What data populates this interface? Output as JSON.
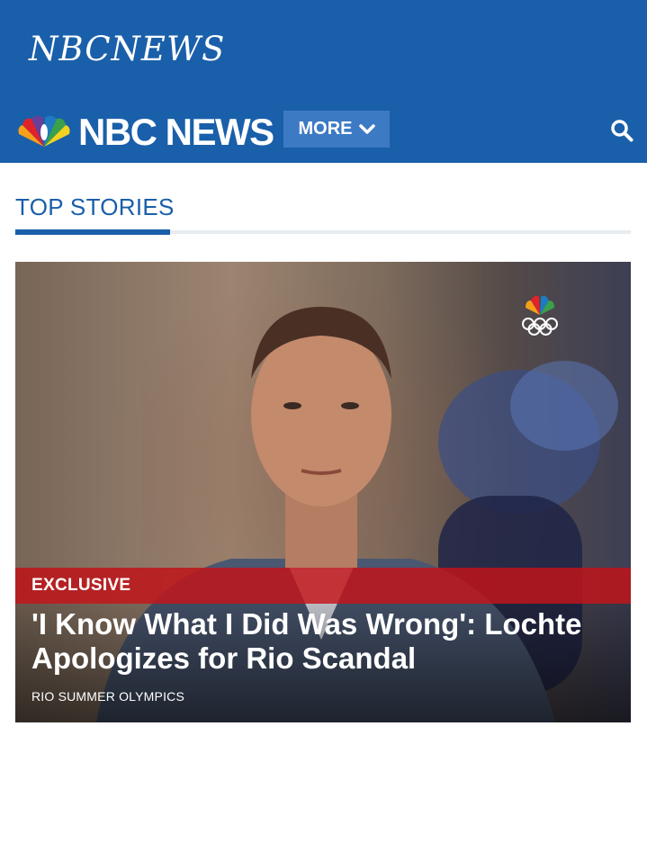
{
  "ad_banner": {
    "logo_text": "NBCNEWS"
  },
  "navbar": {
    "brand": "NBC NEWS",
    "more_label": "MORE"
  },
  "section": {
    "title": "TOP STORIES"
  },
  "hero_story": {
    "badge": "EXCLUSIVE",
    "headline": "'I Know What I Did Was Wrong': Lochte Apologizes for Rio Scandal",
    "category": "RIO SUMMER OLYMPICS"
  },
  "icons": [
    "peacock-logo-icon",
    "chevron-down-icon",
    "search-icon",
    "olympic-rings-icon"
  ],
  "colors": {
    "brand_blue": "#1a5faa",
    "button_blue": "#3d7ac4",
    "badge_red": "#be1419",
    "rule_gray": "#e7ecf1"
  }
}
